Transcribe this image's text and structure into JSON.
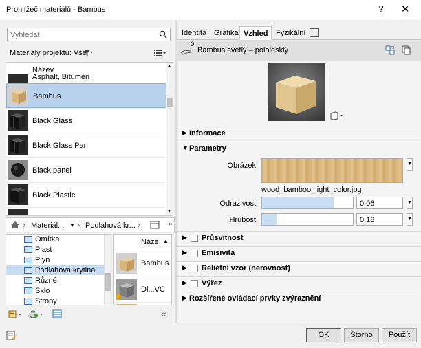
{
  "window": {
    "title": "Prohlížeč materiálů - Bambus",
    "help": "?",
    "close": "✕"
  },
  "search": {
    "placeholder": "Vyhledat"
  },
  "project": {
    "label": "Materiály projektu: Vše"
  },
  "list": {
    "header": "Název",
    "peek": "Asphalt, Bitumen",
    "items": [
      {
        "name": "Bambus"
      },
      {
        "name": "Black Glass"
      },
      {
        "name": "Black Glass Pan"
      },
      {
        "name": "Black panel"
      },
      {
        "name": "Black Plastic"
      }
    ]
  },
  "breadcrumb": {
    "item1": "Materiál...",
    "item2": "Podlahová kr..."
  },
  "tree": {
    "items": [
      "Omítka",
      "Plast",
      "Plyn",
      "Podlahová krytina",
      "Různé",
      "Sklo",
      "Stropy"
    ]
  },
  "grid": {
    "header": "Náze",
    "items": [
      "Bambus",
      "Dl...VC"
    ]
  },
  "tabs": {
    "identita": "Identita",
    "grafika": "Grafika",
    "vzhled": "Vzhled",
    "fyzikalni": "Fyzikální",
    "add": "+"
  },
  "asset": {
    "name": "Bambus světlý – pololesklý",
    "badge": "0"
  },
  "sections": {
    "informace": "Informace",
    "parametry": "Parametry",
    "pruhlednost": "Průsvitnost",
    "emisivita": "Emisivita",
    "relief": "Reliéfní vzor (nerovnost)",
    "vyrez": "Výřez",
    "rozsirene": "Rozšířené ovládací prvky zvýraznění"
  },
  "params": {
    "image_label": "Obrázek",
    "image_file": "wood_bamboo_light_color.jpg",
    "reflect_label": "Odrazivost",
    "reflect_value": "0,06",
    "reflect_level": 0.79,
    "rough_label": "Hrubost",
    "rough_value": "0,18",
    "rough_level": 0.16
  },
  "buttons": {
    "ok": "OK",
    "cancel": "Storno",
    "apply": "Použít"
  },
  "colors": {
    "selection": "#b8d2ee",
    "accent": "#0078d7",
    "wood": "#d9b57c"
  }
}
